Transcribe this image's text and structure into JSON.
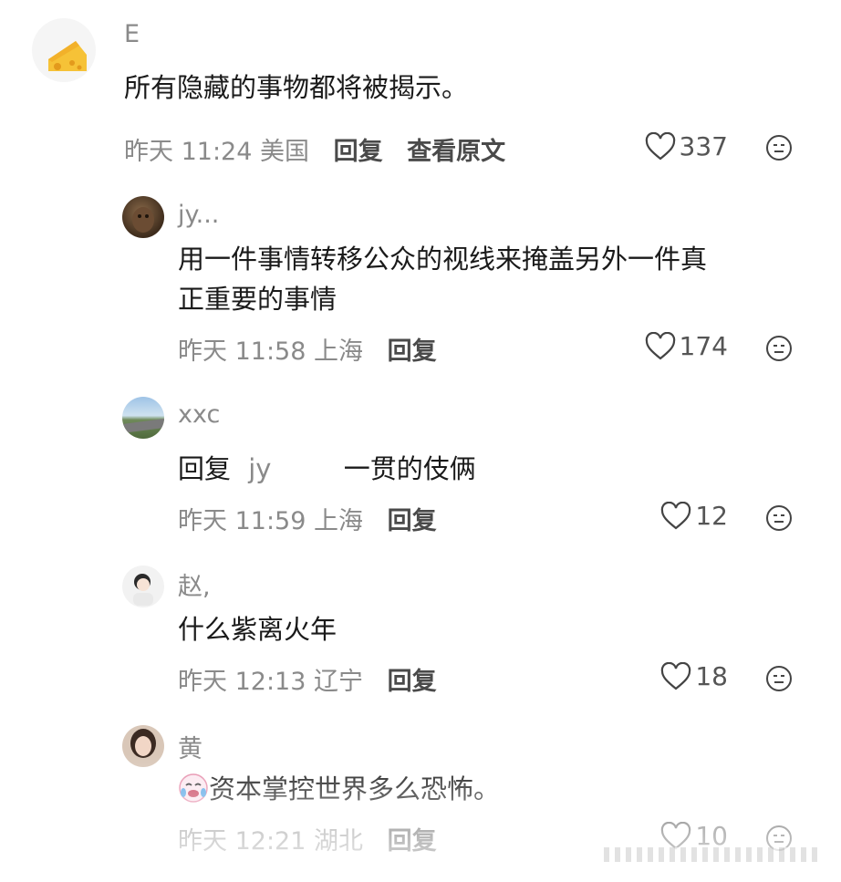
{
  "comments": [
    {
      "name": "E",
      "text_lines": [
        "所有隐藏的事物都将被揭示。"
      ],
      "time": "昨天 11:24",
      "location": "美国",
      "reply_label": "回复",
      "view_original_label": "查看原文",
      "likes": "337",
      "avatar_icon": "cheese-icon"
    },
    {
      "name": "jy...",
      "text_lines": [
        "用一件事情转移公众的视线来掩盖另外一件真",
        "正重要的事情"
      ],
      "time": "昨天 11:58",
      "location": "上海",
      "reply_label": "回复",
      "likes": "174",
      "avatar_icon": "bear-photo-avatar"
    },
    {
      "name": "xxc",
      "reply_prefix": "回复",
      "reply_to": "jy",
      "text_after": "一贯的伎俩",
      "time": "昨天 11:59",
      "location": "上海",
      "reply_label": "回复",
      "likes": "12",
      "avatar_icon": "landscape-photo-avatar"
    },
    {
      "name": "赵,",
      "text_lines": [
        "什么紫离火年"
      ],
      "time": "昨天 12:13",
      "location": "辽宁",
      "reply_label": "回复",
      "likes": "18",
      "avatar_icon": "anime-girl-avatar"
    },
    {
      "name": "黄",
      "text_lines": [
        "资本掌控世界多么恐怖。"
      ],
      "time": "昨天 12:21",
      "location": "湖北",
      "reply_label": "回复",
      "likes": "10",
      "avatar_icon": "woman-photo-avatar"
    }
  ],
  "colors": {
    "meta_gray": "#8a8a8a",
    "text": "#1a1a1a",
    "cheese": "#f6c237"
  }
}
